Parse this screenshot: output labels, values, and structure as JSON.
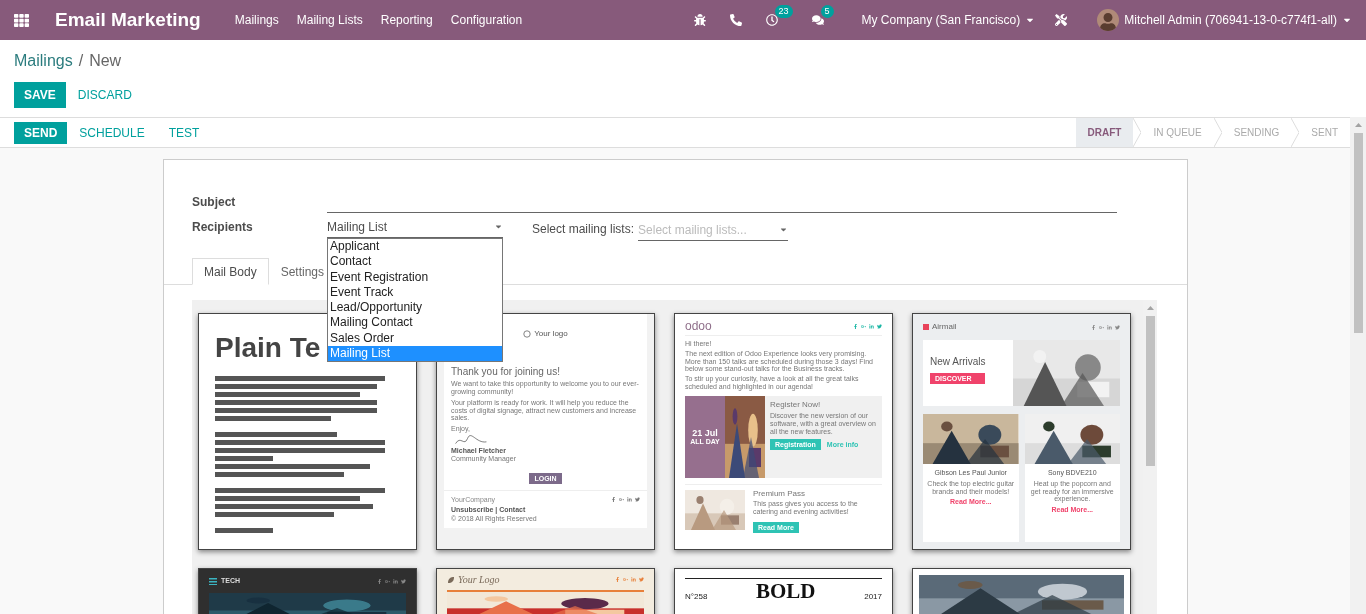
{
  "navbar": {
    "app_title": "Email Marketing",
    "menu": [
      "Mailings",
      "Mailing Lists",
      "Reporting",
      "Configuration"
    ],
    "activity_count": "23",
    "message_count": "5",
    "company": "My Company (San Francisco)",
    "user": "Mitchell Admin (706941-13-0-c774f1-all)"
  },
  "breadcrumb": {
    "parent": "Mailings",
    "separator": "/",
    "current": "New"
  },
  "actions": [
    "SAVE",
    "DISCARD"
  ],
  "status_actions": [
    "SEND",
    "SCHEDULE",
    "TEST"
  ],
  "stages": [
    {
      "label": "DRAFT",
      "selected": true
    },
    {
      "label": "IN QUEUE",
      "selected": false
    },
    {
      "label": "SENDING",
      "selected": false
    },
    {
      "label": "SENT",
      "selected": false
    }
  ],
  "form": {
    "subject_label": "Subject",
    "recipients_label": "Recipients",
    "recipients_value": "Mailing List",
    "recipients_options": [
      {
        "label": "Applicant",
        "selected": false
      },
      {
        "label": "Contact",
        "selected": false
      },
      {
        "label": "Event Registration",
        "selected": false
      },
      {
        "label": "Event Track",
        "selected": false
      },
      {
        "label": "Lead/Opportunity",
        "selected": false
      },
      {
        "label": "Mailing Contact",
        "selected": false
      },
      {
        "label": "Sales Order",
        "selected": false
      },
      {
        "label": "Mailing List",
        "selected": true
      }
    ],
    "mailing_lists_label": "Select mailing lists:",
    "mailing_lists_placeholder": "Select mailing lists..."
  },
  "tabs": [
    {
      "label": "Mail Body",
      "selected": true
    },
    {
      "label": "Settings",
      "selected": false
    }
  ],
  "templates": [
    {
      "kind": "plain",
      "title": "Plain Te"
    },
    {
      "kind": "welcome",
      "logo": "Your logo",
      "title": "Thank you for joining us!",
      "paragraphs": [
        "We want to take this opportunity to welcome you to our ever-growing community!",
        "Your platform is ready for work. It will help you reduce the costs of digital signage, attract new customers and increase sales.",
        "Enjoy,"
      ],
      "signer": "Michael Fletcher",
      "signer_role": "Community Manager",
      "button": "LOGIN",
      "company": "YourCompany",
      "links": "Unsubscribe | Contact",
      "copyright": "© 2018 All Rights Reserved"
    },
    {
      "kind": "event",
      "logo": "odoo",
      "greeting": "Hi there!",
      "paragraphs": [
        "The next edition of Odoo Experience looks very promising. More than 150 talks are scheduled during those 3 days! Find below some stand-out talks for the Business tracks.",
        "To stir up your curiosity, have a look at all the great talks scheduled and highlighted in our agenda!"
      ],
      "date": "21 Jul",
      "date_note": "ALL DAY",
      "event_title": "Register Now!",
      "event_text": "Discover the new version of our software, with a great overview on all the new features.",
      "event_button": "Registration",
      "event_link": "More info",
      "pass_title": "Premium Pass",
      "pass_text": "This pass gives you access to the catering and evening activities!",
      "pass_button": "Read More"
    },
    {
      "kind": "newsletter",
      "brand": "Airmail",
      "hero_title": "New Arrivals",
      "hero_button": "DISCOVER",
      "products": [
        {
          "name": "Gibson Les Paul Junior",
          "text": "Check the top electric guitar brands and their models!",
          "link": "Read More..."
        },
        {
          "name": "Sony BDVE210",
          "text": "Heat up the popcorn and get ready for an immersive experience.",
          "link": "Read More..."
        }
      ]
    },
    {
      "kind": "tech",
      "brand": "TECH"
    },
    {
      "kind": "logo",
      "logo": "Your Logo"
    },
    {
      "kind": "bold",
      "issue": "N°258",
      "title": "BOLD",
      "year": "2017"
    },
    {
      "kind": "expo"
    }
  ]
}
